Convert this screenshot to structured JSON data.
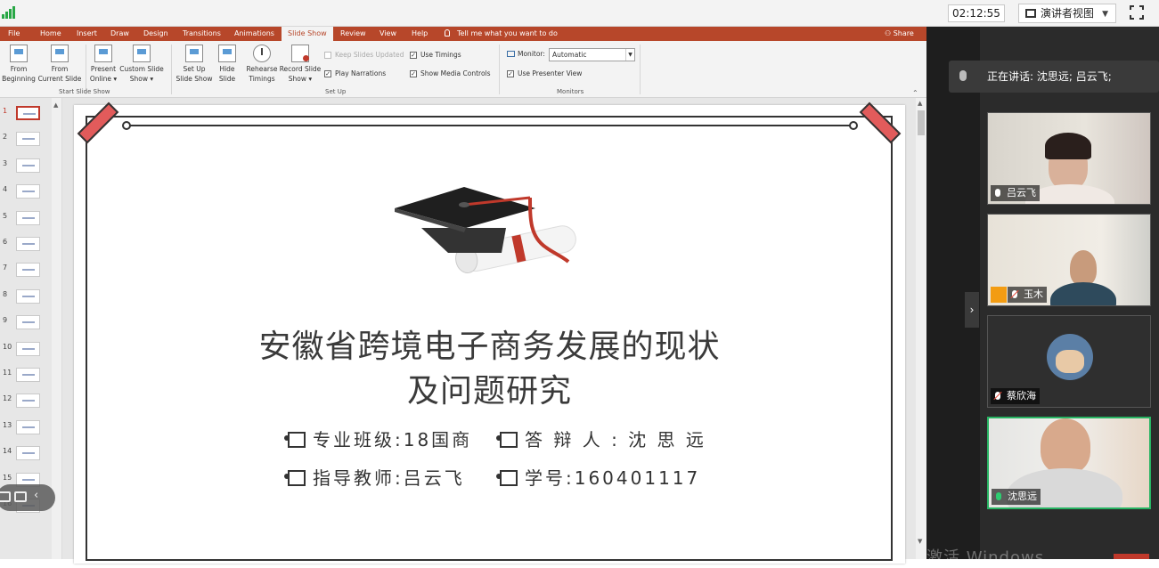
{
  "topbar": {
    "timer": "02:12:55",
    "presenter_view": "演讲者视图"
  },
  "ribbon": {
    "tabs": [
      "File",
      "Home",
      "Insert",
      "Draw",
      "Design",
      "Transitions",
      "Animations",
      "Slide Show",
      "Review",
      "View",
      "Help"
    ],
    "active_tab": "Slide Show",
    "tell_me": "Tell me what you want to do",
    "share": "Share",
    "buttons": {
      "from_beginning": [
        "From",
        "Beginning"
      ],
      "from_current": [
        "From",
        "Current Slide"
      ],
      "present_online": [
        "Present",
        "Online ▾"
      ],
      "custom_show": [
        "Custom Slide",
        "Show ▾"
      ],
      "set_up": [
        "Set Up",
        "Slide Show"
      ],
      "hide_slide": [
        "Hide",
        "Slide"
      ],
      "rehearse": [
        "Rehearse",
        "Timings"
      ],
      "record": [
        "Record Slide",
        "Show ▾"
      ]
    },
    "checks": {
      "keep_updated": "Keep Slides Updated",
      "play_narrations": "Play Narrations",
      "use_timings": "Use Timings",
      "show_media": "Show Media Controls",
      "presenter_view": "Use Presenter View"
    },
    "monitor_label": "Monitor:",
    "monitor_value": "Automatic",
    "groups": {
      "start": "Start Slide Show",
      "setup": "Set Up",
      "monitors": "Monitors"
    }
  },
  "thumbnails": [
    "1",
    "2",
    "3",
    "4",
    "5",
    "6",
    "7",
    "8",
    "9",
    "10",
    "11",
    "12",
    "13",
    "14",
    "15",
    "16"
  ],
  "slide": {
    "title_line1": "安徽省跨境电子商务发展的现状",
    "title_line2": "及问题研究",
    "major": "专业班级:18国商",
    "defender": "答 辩 人 : 沈 思 远",
    "advisor": "指导教师:吕云飞",
    "student_id": "学号:160401117"
  },
  "meeting": {
    "speaking": "正在讲话: 沈思远; 吕云飞;",
    "participants": [
      {
        "name": "吕云飞"
      },
      {
        "name": "玉木"
      },
      {
        "name": "蔡欣海"
      },
      {
        "name": "沈思远"
      }
    ],
    "watermark": "激活 Windows"
  }
}
